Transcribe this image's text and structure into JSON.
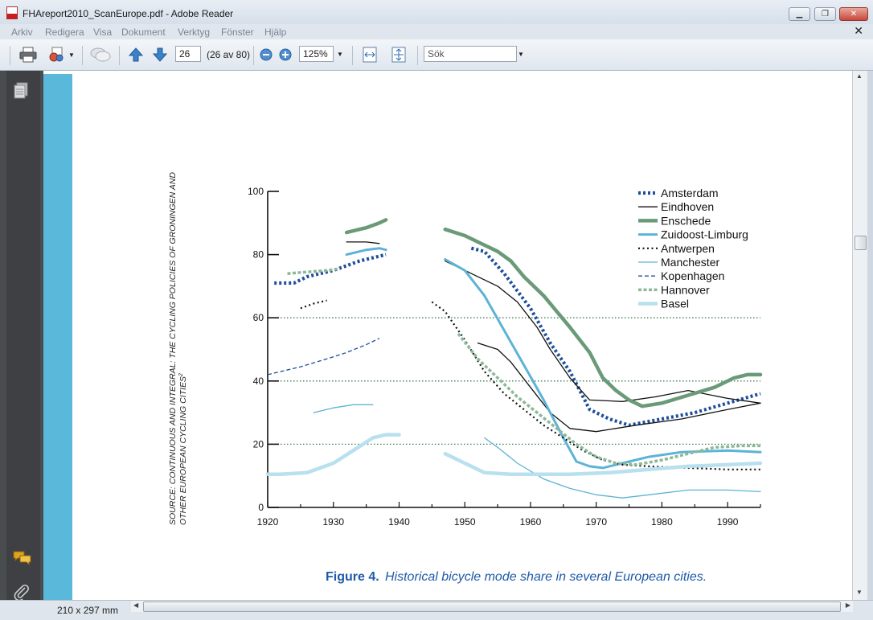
{
  "window": {
    "title": "FHAreport2010_ScanEurope.pdf - Adobe Reader",
    "icon": "pdf-document-icon"
  },
  "menu": {
    "items": [
      "Arkiv",
      "Redigera",
      "Visa",
      "Dokument",
      "Verktyg",
      "Fönster",
      "Hjälp"
    ]
  },
  "toolbar": {
    "page_number": "26",
    "page_count": "(26 av 80)",
    "zoom": "125%",
    "search_placeholder": "Sök"
  },
  "status": {
    "page_size": "210 x 297 mm"
  },
  "figure": {
    "caption_label": "Figure 4.",
    "caption_text": "Historical bicycle mode share in several European cities.",
    "source_line1": "SOURCE: CONTINUOUS AND INTEGRAL: THE CYCLING POLICIES OF GRONINGEN AND",
    "source_line2": "OTHER EUROPEAN CYCLING CITIES",
    "source_sup": "2"
  },
  "chart_data": {
    "type": "line",
    "title": "",
    "xlabel": "",
    "ylabel": "",
    "xlim": [
      1920,
      1995
    ],
    "ylim": [
      0,
      100
    ],
    "x_ticks": [
      1920,
      1930,
      1940,
      1950,
      1960,
      1970,
      1980,
      1990
    ],
    "y_ticks": [
      0,
      20,
      40,
      60,
      80,
      100
    ],
    "gridlines": [
      20,
      40,
      60
    ],
    "legend_position": "top-right",
    "series": [
      {
        "name": "Amsterdam",
        "color": "#1f4e9a",
        "style": "dotted-thick",
        "segments": [
          [
            [
              1921,
              71
            ],
            [
              1924,
              71
            ],
            [
              1926,
              73
            ],
            [
              1930,
              75
            ],
            [
              1934,
              78
            ],
            [
              1938,
              80
            ]
          ],
          [
            [
              1951,
              82
            ],
            [
              1953,
              81
            ],
            [
              1956,
              74
            ],
            [
              1960,
              63
            ],
            [
              1963,
              52
            ],
            [
              1966,
              43
            ],
            [
              1969,
              31
            ],
            [
              1972,
              28
            ],
            [
              1975,
              26
            ],
            [
              1980,
              28
            ],
            [
              1985,
              30
            ],
            [
              1990,
              33
            ],
            [
              1995,
              36
            ]
          ]
        ]
      },
      {
        "name": "Eindhoven",
        "color": "#111111",
        "style": "thin",
        "segments": [
          [
            [
              1932,
              84
            ],
            [
              1935,
              84
            ],
            [
              1937,
              83.5
            ]
          ],
          [
            [
              1947,
              78
            ],
            [
              1951,
              74
            ],
            [
              1955,
              70
            ],
            [
              1958,
              65
            ],
            [
              1961,
              57
            ],
            [
              1963,
              50
            ],
            [
              1966,
              41
            ],
            [
              1969,
              34
            ],
            [
              1974,
              33.5
            ],
            [
              1979,
              35
            ],
            [
              1984,
              37
            ],
            [
              1990,
              34.5
            ],
            [
              1995,
              33
            ]
          ],
          [
            [
              1952,
              52
            ],
            [
              1955,
              50
            ],
            [
              1957,
              46
            ],
            [
              1960,
              38
            ],
            [
              1963,
              30
            ],
            [
              1966,
              25
            ],
            [
              1970,
              24
            ],
            [
              1976,
              26
            ],
            [
              1983,
              28
            ],
            [
              1990,
              31
            ],
            [
              1995,
              33
            ]
          ]
        ]
      },
      {
        "name": "Enschede",
        "color": "#6a9a78",
        "style": "thick",
        "segments": [
          [
            [
              1932,
              87
            ],
            [
              1935,
              88.5
            ],
            [
              1937,
              90
            ],
            [
              1938,
              91
            ]
          ],
          [
            [
              1947,
              88
            ],
            [
              1950,
              86
            ],
            [
              1952,
              84
            ],
            [
              1955,
              81
            ],
            [
              1957,
              78
            ],
            [
              1959,
              73
            ],
            [
              1962,
              67
            ],
            [
              1964,
              62
            ],
            [
              1966,
              57
            ],
            [
              1969,
              49
            ],
            [
              1971,
              41
            ],
            [
              1973,
              37
            ],
            [
              1975,
              34
            ],
            [
              1977,
              32
            ],
            [
              1980,
              33
            ],
            [
              1984,
              35.5
            ],
            [
              1988,
              38
            ],
            [
              1991,
              41
            ],
            [
              1993,
              42
            ],
            [
              1995,
              42
            ]
          ]
        ]
      },
      {
        "name": "Zuidoost-Limburg",
        "color": "#5cb3d6",
        "style": "medium",
        "segments": [
          [
            [
              1932,
              80
            ],
            [
              1935,
              81.5
            ],
            [
              1937,
              82
            ],
            [
              1938,
              81.5
            ]
          ],
          [
            [
              1947,
              78.5
            ],
            [
              1950,
              75
            ],
            [
              1953,
              67
            ],
            [
              1956,
              56
            ],
            [
              1959,
              45
            ],
            [
              1962,
              34
            ],
            [
              1965,
              22
            ],
            [
              1967,
              14.5
            ],
            [
              1969,
              13
            ],
            [
              1971,
              12.5
            ],
            [
              1974,
              14
            ],
            [
              1978,
              16
            ],
            [
              1983,
              17.5
            ],
            [
              1990,
              18
            ],
            [
              1995,
              17.5
            ]
          ]
        ]
      },
      {
        "name": "Antwerpen",
        "color": "#111111",
        "style": "dotted",
        "segments": [
          [
            [
              1925,
              63
            ],
            [
              1927,
              64.5
            ],
            [
              1929,
              65.5
            ]
          ],
          [
            [
              1945,
              65
            ],
            [
              1947,
              62
            ],
            [
              1950,
              53
            ],
            [
              1953,
              43
            ],
            [
              1956,
              36
            ],
            [
              1959,
              31
            ],
            [
              1962,
              26
            ],
            [
              1965,
              22
            ],
            [
              1968,
              18
            ],
            [
              1971,
              15
            ],
            [
              1974,
              13.5
            ],
            [
              1978,
              13
            ],
            [
              1984,
              12.5
            ],
            [
              1990,
              12
            ],
            [
              1995,
              12
            ]
          ]
        ]
      },
      {
        "name": "Manchester",
        "color": "#5cb3d6",
        "style": "thin",
        "segments": [
          [
            [
              1927,
              30
            ],
            [
              1930,
              31.5
            ],
            [
              1933,
              32.5
            ],
            [
              1936,
              32.5
            ]
          ],
          [
            [
              1953,
              22
            ],
            [
              1955,
              19
            ],
            [
              1958,
              14
            ],
            [
              1962,
              9
            ],
            [
              1966,
              6
            ],
            [
              1970,
              4
            ],
            [
              1974,
              3
            ],
            [
              1978,
              4
            ],
            [
              1984,
              5.5
            ],
            [
              1990,
              5.5
            ],
            [
              1995,
              5
            ]
          ]
        ]
      },
      {
        "name": "Kopenhagen",
        "color": "#1f4e9a",
        "style": "dashed",
        "segments": [
          [
            [
              1920,
              42
            ],
            [
              1922,
              43
            ],
            [
              1925,
              44.5
            ],
            [
              1929,
              47
            ],
            [
              1932,
              49
            ],
            [
              1935,
              51.5
            ],
            [
              1937,
              53.5
            ]
          ]
        ]
      },
      {
        "name": "Hannover",
        "color": "#8db89a",
        "style": "dashed-thick",
        "segments": [
          [
            [
              1923,
              74
            ],
            [
              1926,
              74.5
            ],
            [
              1929,
              75
            ],
            [
              1931,
              75.5
            ]
          ],
          [
            [
              1949,
              55
            ],
            [
              1952,
              47
            ],
            [
              1955,
              41
            ],
            [
              1958,
              35
            ],
            [
              1961,
              30
            ],
            [
              1964,
              25
            ],
            [
              1967,
              20
            ],
            [
              1970,
              16
            ],
            [
              1973,
              14
            ],
            [
              1976,
              13.5
            ],
            [
              1980,
              15
            ],
            [
              1984,
              17
            ],
            [
              1988,
              19
            ],
            [
              1992,
              19.5
            ],
            [
              1995,
              19.5
            ]
          ]
        ]
      },
      {
        "name": "Basel",
        "color": "#b8e0ee",
        "style": "thick",
        "segments": [
          [
            [
              1920,
              10.5
            ],
            [
              1922,
              10.5
            ],
            [
              1926,
              11
            ],
            [
              1930,
              14
            ],
            [
              1933,
              18
            ],
            [
              1936,
              22
            ],
            [
              1938,
              23
            ],
            [
              1940,
              23
            ]
          ],
          [
            [
              1947,
              17
            ],
            [
              1950,
              14
            ],
            [
              1953,
              11
            ],
            [
              1957,
              10.5
            ],
            [
              1962,
              10.5
            ],
            [
              1966,
              10.5
            ],
            [
              1972,
              11
            ],
            [
              1978,
              12
            ],
            [
              1984,
              13
            ],
            [
              1990,
              13.5
            ],
            [
              1995,
              14
            ]
          ]
        ]
      }
    ]
  }
}
